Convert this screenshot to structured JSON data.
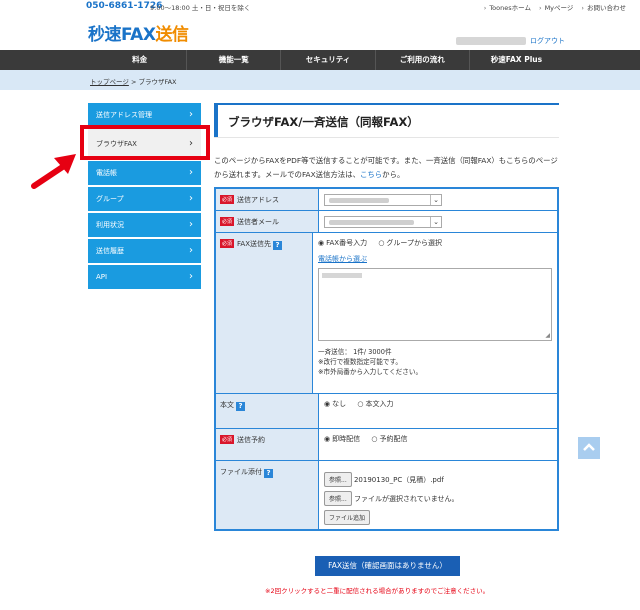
{
  "topbar": {
    "phone": "050-6861-1726",
    "hours": "9:00〜18:00 土・日・祝日を除く",
    "links": [
      "Toonesホーム",
      "Myページ",
      "お問い合わせ"
    ]
  },
  "logo": {
    "part1": "秒速",
    "part2": "FAX",
    "part3": "送信"
  },
  "header": {
    "logout": "ログアウト"
  },
  "nav": [
    "料金",
    "機能一覧",
    "セキュリティ",
    "ご利用の流れ",
    "秒速FAX Plus"
  ],
  "breadcrumb": {
    "home": "トップページ",
    "sep": " > ",
    "current": "ブラウザFAX"
  },
  "sidebar": {
    "items": [
      {
        "label": "送信アドレス管理"
      },
      {
        "label": "ブラウザFAX"
      },
      {
        "label": "電話帳"
      },
      {
        "label": "グループ"
      },
      {
        "label": "利用状況"
      },
      {
        "label": "送信履歴"
      },
      {
        "label": "API"
      }
    ],
    "active_index": 1
  },
  "main": {
    "title": "ブラウザFAX/一斉送信（同報FAX）",
    "intro": "このページからFAXをPDF等で送信することが可能です。また、一斉送信（同報FAX）もこちらのページから送れます。メールでのFAX送信方法は、",
    "intro_link": "こちら",
    "intro_end": "から。"
  },
  "form": {
    "required_tag": "必須",
    "help_icon": "?",
    "sender_address_label": "送信アドレス",
    "sender_email_label": "送信者メール",
    "fax_dest_label": "FAX送信先",
    "dest_radio_manual": "FAX番号入力",
    "dest_radio_group": "グループから選択",
    "phonebook_link": "電話帳から選ぶ",
    "count_text": "一斉送信： 1件/ 3000件",
    "note1": "※改行で複数指定可能です。",
    "note2": "※市外局番から入力してください。",
    "body_label": "本文",
    "body_radio_none": "なし",
    "body_radio_input": "本文入力",
    "schedule_label": "送信予約",
    "schedule_radio_now": "即時配信",
    "schedule_radio_reserve": "予約配信",
    "attach_label": "ファイル添付",
    "browse_label": "参照...",
    "file1_name": "20190130_PC（見積）.pdf",
    "file2_name": "ファイルが選択されていません。",
    "add_file_label": "ファイル追加"
  },
  "submit_label": "FAX送信（確認画面はありません）",
  "warning": "※2回クリックすると二重に配信される場合がありますのでご注意ください。",
  "colors": {
    "accent": "#1a9be0",
    "brand_blue": "#1a73c8",
    "brand_orange": "#f08c00",
    "highlight_red": "#e60012"
  }
}
